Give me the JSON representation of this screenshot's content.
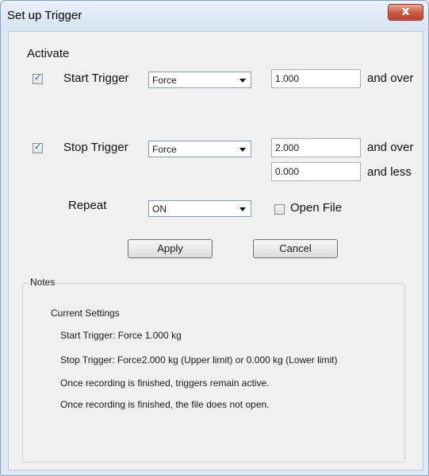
{
  "window": {
    "title": "Set up Trigger",
    "close_symbol": "x"
  },
  "activate": {
    "label": "Activate"
  },
  "start_trigger": {
    "checked": true,
    "check_mark": "✓",
    "label": "Start Trigger",
    "select_value": "Force",
    "value": "1.000",
    "suffix": "and over"
  },
  "stop_trigger": {
    "checked": true,
    "check_mark": "✓",
    "label": "Stop Trigger",
    "select_value": "Force",
    "upper_value": "2.000",
    "upper_suffix": "and over",
    "lower_value": "0.000",
    "lower_suffix": "and less"
  },
  "repeat": {
    "label": "Repeat",
    "select_value": "ON"
  },
  "open_file": {
    "checked": false,
    "label": "Open File"
  },
  "buttons": {
    "apply": "Apply",
    "cancel": "Cancel"
  },
  "notes": {
    "legend": "Notes",
    "heading": "Current Settings",
    "lines": [
      "Start Trigger: Force 1.000 kg",
      "Stop Trigger: Force2.000 kg (Upper limit) or  0.000 kg (Lower limit)",
      "Once recording is finished, triggers remain active.",
      "Once recording is finished, the file does not open."
    ]
  }
}
